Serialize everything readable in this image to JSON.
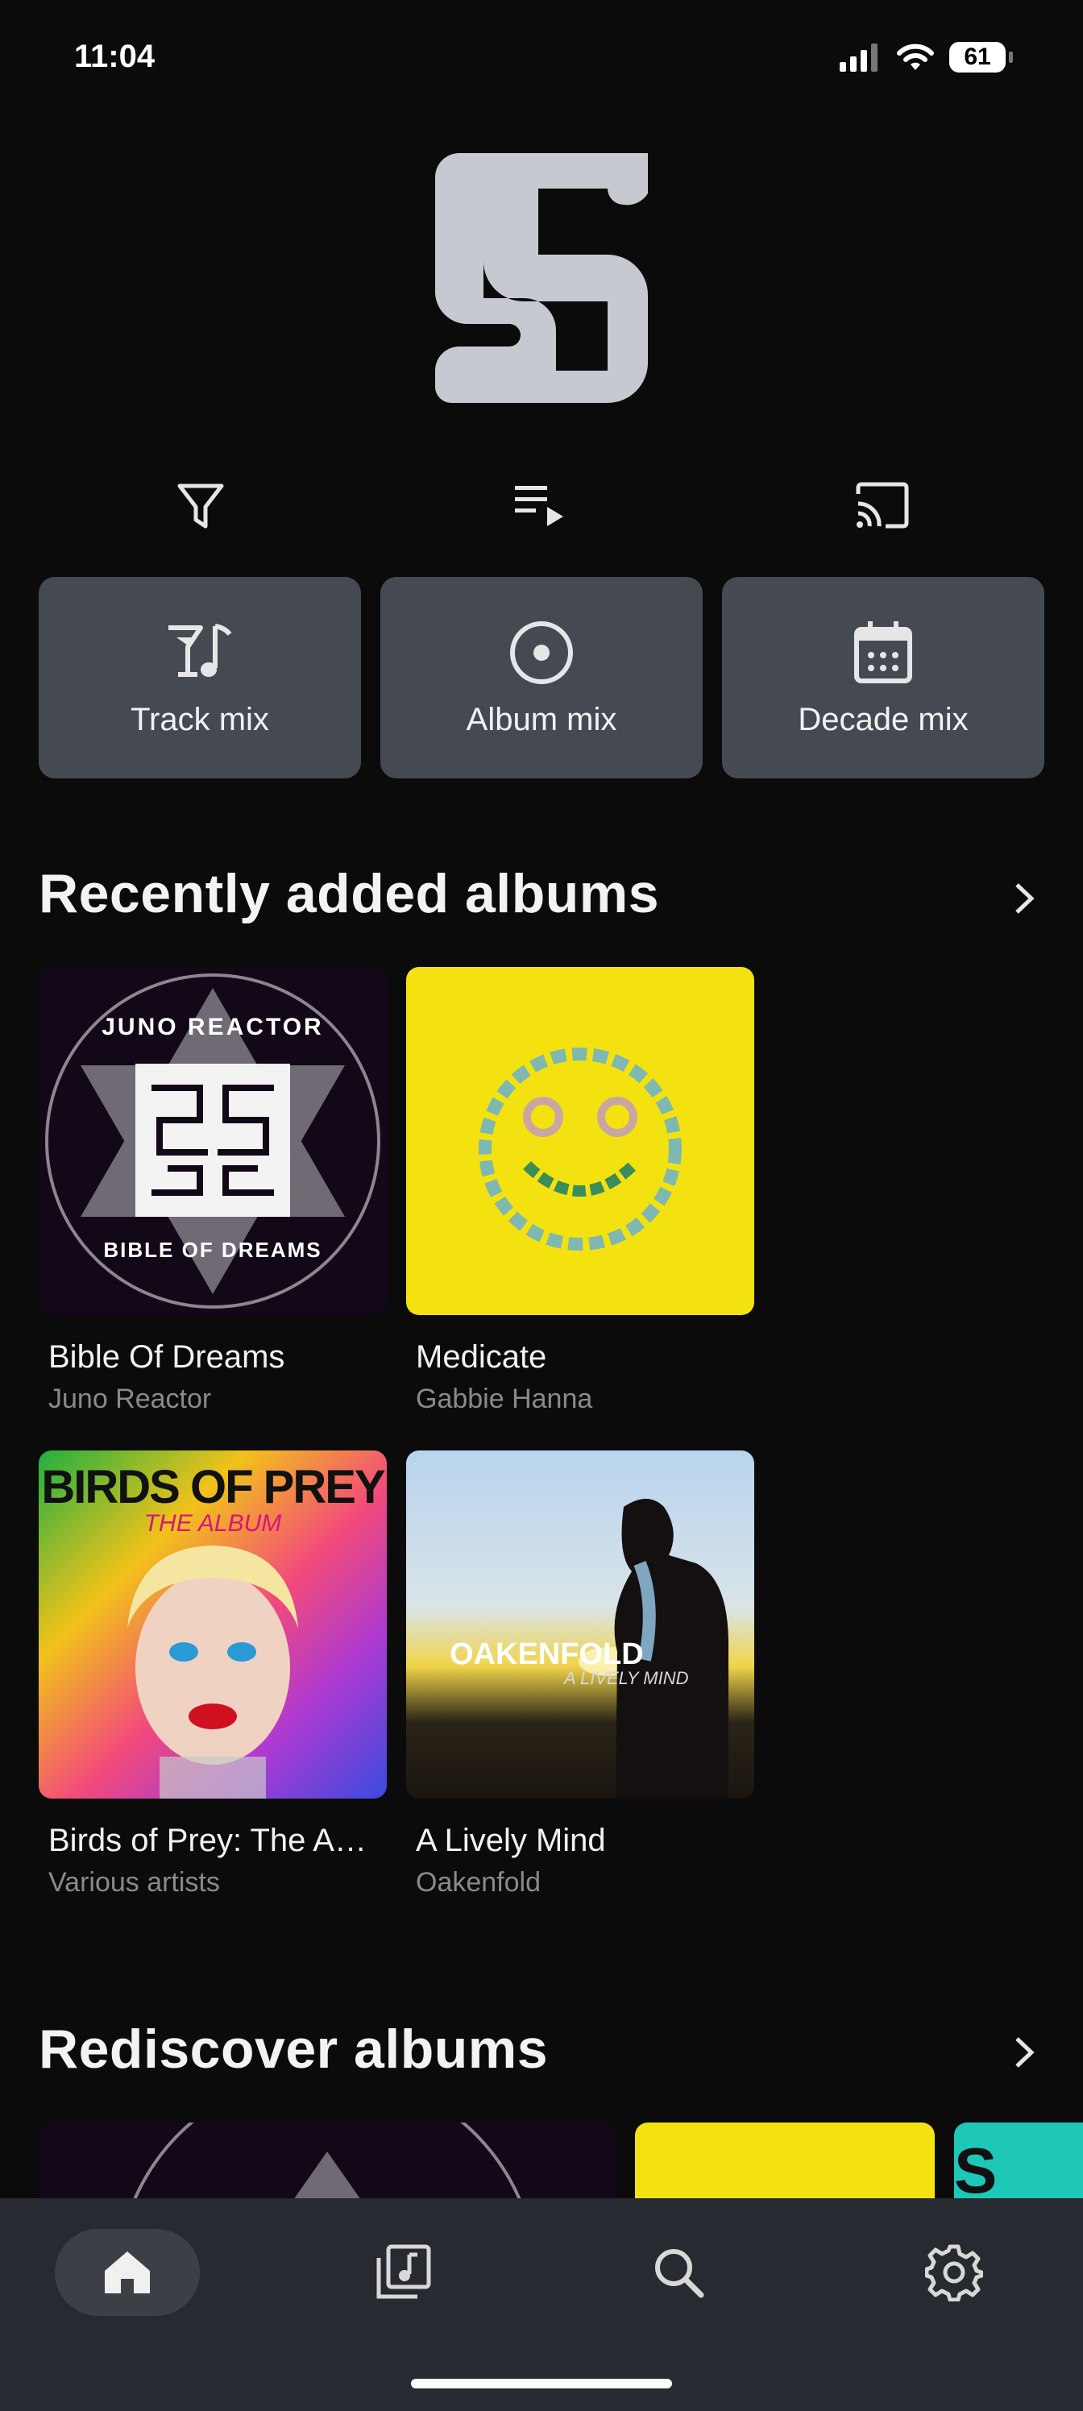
{
  "status": {
    "time": "11:04",
    "battery": "61"
  },
  "mixes": [
    {
      "label": "Track mix",
      "icon": "cocktail-note-icon"
    },
    {
      "label": "Album mix",
      "icon": "disc-icon"
    },
    {
      "label": "Decade mix",
      "icon": "calendar-icon"
    }
  ],
  "sections": {
    "recent": {
      "title": "Recently added albums",
      "albums": [
        {
          "title": "Bible Of Dreams",
          "artist": "Juno Reactor",
          "cover_text_top": "JUNO REACTOR",
          "cover_text_bottom": "BIBLE OF DREAMS"
        },
        {
          "title": "Medicate",
          "artist": "Gabbie Hanna"
        },
        {
          "title": "Birds of Prey: The A…",
          "artist": "Various artists",
          "cover_text_top": "BIRDS OF PREY",
          "cover_text_sub": "THE ALBUM"
        },
        {
          "title": "A Lively Mind",
          "artist": "Oakenfold",
          "cover_text_top": "OAKENFOLD",
          "cover_text_sub": "A LIVELY MIND"
        }
      ]
    },
    "rediscover": {
      "title": "Rediscover albums",
      "partial_text": "S OF"
    }
  },
  "colors": {
    "background": "#0b0b0b",
    "card": "#454a52",
    "nav": "#272a30",
    "muted": "#8a8a8a"
  }
}
